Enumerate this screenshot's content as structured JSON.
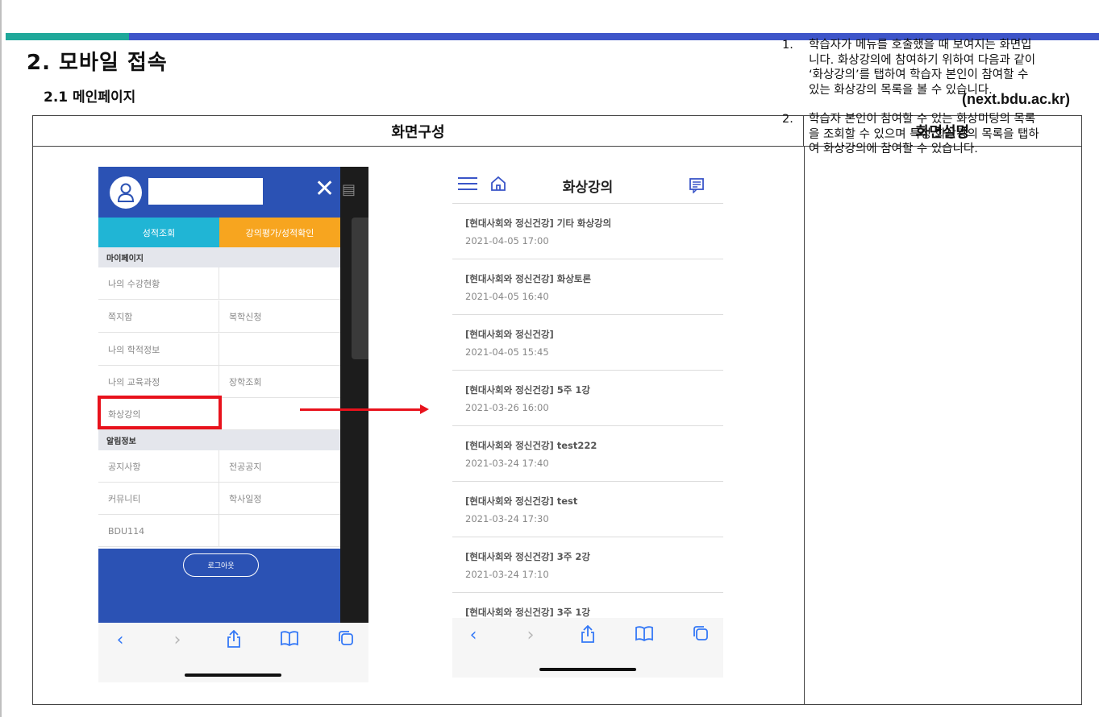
{
  "section_title": "2. 모바일 접속",
  "subsection_title": "2.1 메인페이지",
  "site_url": "(next.bdu.ac.kr)",
  "table": {
    "header_left": "화면구성",
    "header_right": "화면설명"
  },
  "descriptions": [
    {
      "num": "1.",
      "text": "학습자가 메뉴를 호출했을 때 보여지는 화면입니다. 화상강의에 참여하기 위하여 다음과 같이 ‘화상강의’를 탭하여 학습자 본인이 참여할 수 있는 화상강의 목록을 볼 수 있습니다."
    },
    {
      "num": "2.",
      "text": "학습자 본인이 참여할 수 있는 화상미팅의 목록을 조회할 수 있으며 특정 화상강의 목록을 탭하여 화상강의에 참여할 수 있습니다."
    }
  ],
  "menu_screen": {
    "close_icon": "close-icon",
    "tabs": [
      "성적조회",
      "강의평가/성적확인"
    ],
    "sections": [
      {
        "label": "마이페이지",
        "rows": [
          [
            "나의 수강현황",
            ""
          ],
          [
            "쪽지함",
            "복학신청"
          ],
          [
            "나의 학적정보",
            ""
          ],
          [
            "나의 교육과정",
            "장학조회"
          ],
          [
            "화상강의",
            ""
          ]
        ]
      },
      {
        "label": "알림정보",
        "rows": [
          [
            "공지사항",
            "전공공지"
          ],
          [
            "커뮤니티",
            "학사일정"
          ],
          [
            "BDU114",
            ""
          ]
        ]
      }
    ],
    "logout_label": "로그아웃"
  },
  "lecture_screen": {
    "title": "화상강의",
    "items": [
      {
        "title": "[현대사회와 정신건강] 기타 화상강의",
        "date": "2021-04-05 17:00"
      },
      {
        "title": "[현대사회와 정신건강] 화상토론",
        "date": "2021-04-05 16:40"
      },
      {
        "title": "[현대사회와 정신건강]",
        "date": "2021-04-05 15:45"
      },
      {
        "title": "[현대사회와 정신건강] 5주 1강",
        "date": "2021-03-26 16:00"
      },
      {
        "title": "[현대사회와 정신건강] test222",
        "date": "2021-03-24 17:40"
      },
      {
        "title": "[현대사회와 정신건강] test",
        "date": "2021-03-24 17:30"
      },
      {
        "title": "[현대사회와 정신건강] 3주 2강",
        "date": "2021-03-24 17:10"
      },
      {
        "title": "[현대사회와 정신건강] 3주 1강",
        "date": ""
      }
    ]
  },
  "browser_toolbar_icons": [
    "back-icon",
    "forward-icon",
    "share-icon",
    "bookmarks-icon",
    "tabs-icon"
  ],
  "colors": {
    "accent_blue": "#2b52b4",
    "tab_cyan": "#20b5d5",
    "tab_orange": "#f7a51f",
    "highlight_red": "#e8121c",
    "rule_teal": "#1fa89a",
    "rule_blue": "#3e55c9"
  }
}
